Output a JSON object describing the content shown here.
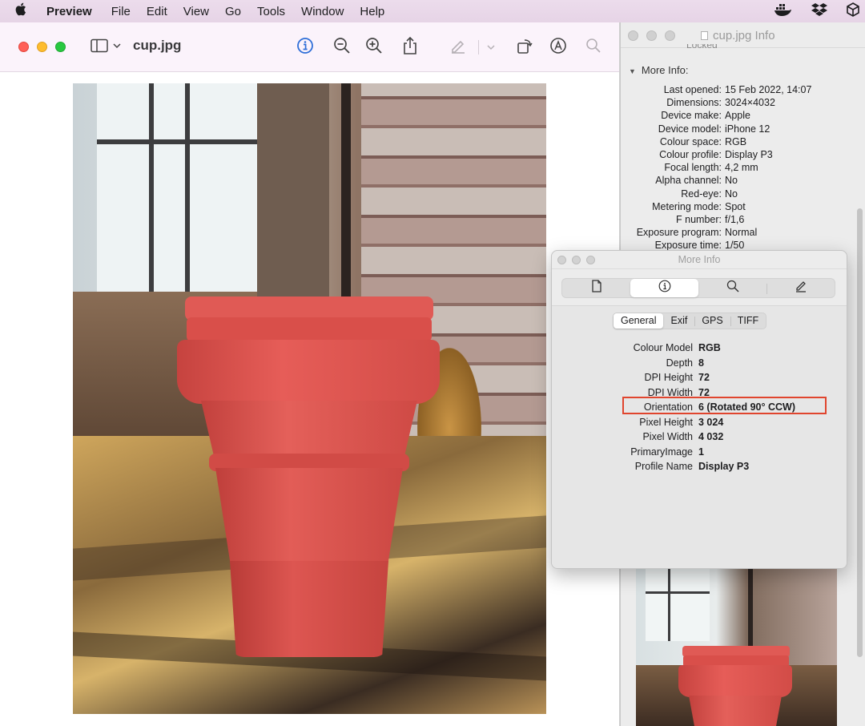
{
  "menubar": {
    "app_name": "Preview",
    "items": [
      "File",
      "Edit",
      "View",
      "Go",
      "Tools",
      "Window",
      "Help"
    ]
  },
  "preview": {
    "title": "cup.jpg"
  },
  "info_window": {
    "title": "cup.jpg Info",
    "clipped_label": "Locked",
    "section": "More Info:",
    "rows": [
      {
        "k": "Last opened:",
        "v": "15 Feb 2022, 14:07"
      },
      {
        "k": "Dimensions:",
        "v": "3024×4032"
      },
      {
        "k": "Device make:",
        "v": "Apple"
      },
      {
        "k": "Device model:",
        "v": "iPhone 12"
      },
      {
        "k": "Colour space:",
        "v": "RGB"
      },
      {
        "k": "Colour profile:",
        "v": "Display P3"
      },
      {
        "k": "Focal length:",
        "v": "4,2 mm"
      },
      {
        "k": "Alpha channel:",
        "v": "No"
      },
      {
        "k": "Red-eye:",
        "v": "No"
      },
      {
        "k": "Metering mode:",
        "v": "Spot"
      },
      {
        "k": "F number:",
        "v": "f/1,6"
      },
      {
        "k": "Exposure program:",
        "v": "Normal"
      },
      {
        "k": "Exposure time:",
        "v": "1/50"
      }
    ]
  },
  "more_info": {
    "title": "More Info",
    "segments": [
      "General",
      "Exif",
      "GPS",
      "TIFF"
    ],
    "properties": [
      {
        "k": "Colour Model",
        "v": "RGB"
      },
      {
        "k": "Depth",
        "v": "8"
      },
      {
        "k": "DPI Height",
        "v": "72"
      },
      {
        "k": "DPI Width",
        "v": "72"
      },
      {
        "k": "Orientation",
        "v": "6 (Rotated 90° CCW)"
      },
      {
        "k": "Pixel Height",
        "v": "3 024"
      },
      {
        "k": "Pixel Width",
        "v": "4 032"
      },
      {
        "k": "PrimaryImage",
        "v": "1"
      },
      {
        "k": "Profile Name",
        "v": "Display P3"
      }
    ],
    "highlight_color": "#e0452e"
  },
  "colors": {
    "accent": "#2f6fd8",
    "cup": "#e0524e"
  }
}
